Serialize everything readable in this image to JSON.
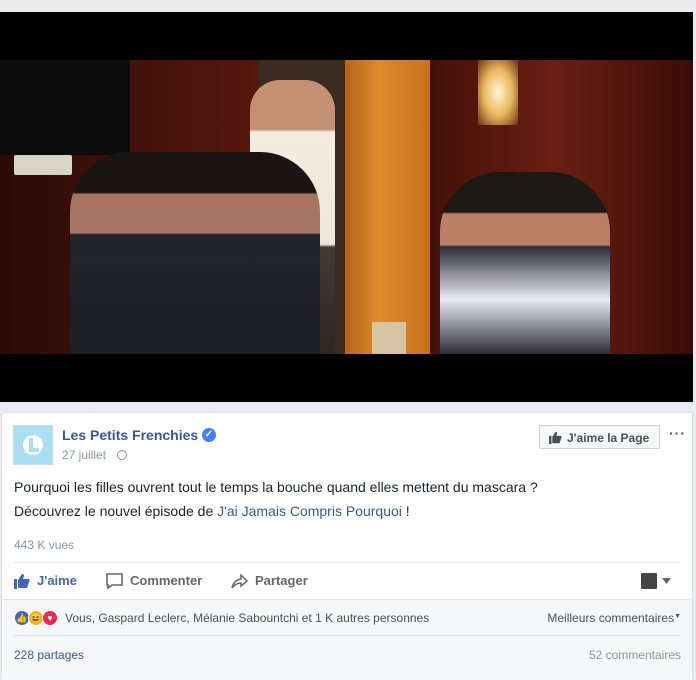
{
  "post": {
    "page_name": "Les Petits Frenchies",
    "date": "27 juillet",
    "like_page_label": "J'aime la Page",
    "text_line1": "Pourquoi les filles ouvrent tout le temps la bouche quand elles mettent du mascara ?",
    "text_line2_prefix": "Découvrez le nouvel épisode de ",
    "text_line2_link": "J'ai Jamais Compris Pourquoi",
    "text_line2_suffix": " !",
    "views": "443 K vues"
  },
  "actions": {
    "like": "J'aime",
    "comment": "Commenter",
    "share": "Partager"
  },
  "reactions": {
    "summary": "Vous, Gaspard Leclerc, Mélanie Sabountchi et 1 K autres personnes",
    "sort_label": "Meilleurs commentaires",
    "shares": "228 partages",
    "comments": "52 commentaires"
  },
  "colors": {
    "link": "#365899",
    "like_blue": "#4267b2",
    "love_red": "#f0284a",
    "haha_yellow": "#f7b125"
  },
  "icons": [
    "verified-badge-icon",
    "globe-icon",
    "thumbs-up-icon",
    "more-icon",
    "comment-icon",
    "share-icon",
    "chevron-down-icon"
  ]
}
